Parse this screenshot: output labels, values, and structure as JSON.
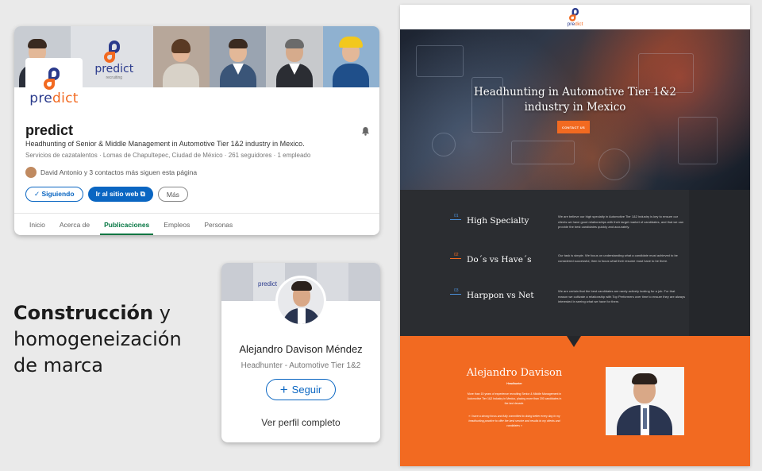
{
  "company_card": {
    "banner_logo_text": "predict",
    "banner_logo_subtext": "recruiting",
    "logo_text_prefix": "pre",
    "logo_text_suffix": "dict",
    "name": "predict",
    "tagline": "Headhunting of Senior & Middle Management in Automotive Tier 1&2 industry in Mexico.",
    "meta": "Servicios de cazatalentos · Lomas de Chapultepec, Ciudad de México · 261 seguidores · 1 empleado",
    "followers_text": "David Antonio y 3 contactos más siguen esta página",
    "actions": {
      "following": "✓ Siguiendo",
      "visit_site": "Ir al sitio web ⧉",
      "more": "Más"
    },
    "tabs": [
      "Inicio",
      "Acerca de",
      "Publicaciones",
      "Empleos",
      "Personas"
    ],
    "active_tab": "Publicaciones"
  },
  "headline": {
    "bold": "Construcción",
    "rest_1": " y",
    "line_2": "homogeneización",
    "line_3": "de marca"
  },
  "profile_card": {
    "banner_logo_text": "predict",
    "name": "Alejandro Davison Méndez",
    "role": "Headhunter - Automotive Tier 1&2",
    "follow_label": "Seguir",
    "follow_icon": "+",
    "view_profile": "Ver perfil completo"
  },
  "website": {
    "logo_text_prefix": "pre",
    "logo_text_suffix": "dict",
    "hero_title_1": "Headhunting in Automotive Tier 1&2",
    "hero_title_2": "industry in Mexico",
    "hero_button": "CONTACT US",
    "features": [
      {
        "num": "01",
        "title": "High Specialty",
        "text": "We are believe our high specialty in Automotive Tier 1&2 industry is key to ensure our clients we have good relationships with their target market of candidates, and that we can provide the best candidates quickly and accurately."
      },
      {
        "num": "02",
        "title": "Do´s vs Have´s",
        "text": "Our task is simple. We focus on understanding what a candidate must achieved to be considered successful, then to focus what their resume must have to be there."
      },
      {
        "num": "03",
        "title": "Harppon vs Net",
        "text": "We are certain that the best candidates are rarely actively looking for a job. For that reason we cultivate a relationship with Top Performers over time to ensure they are always interested in seeing what we have for them."
      }
    ],
    "about": {
      "name": "Alejandro Davison",
      "role": "Headhunter",
      "bio": "More than 15 years of experience recruiting Senior & Middle Management in Automotive Tier 1&2 industry in Mexico, placing more than 200 candidates in the last decade.",
      "quote": "« I have a strong focus and fully committed to doing better every day in my headhunting practice to offer the best service and results to my clients and candidates »"
    }
  },
  "colors": {
    "brand_orange": "#f26a21",
    "brand_navy": "#2a3a8c",
    "linkedin_blue": "#0a66c2",
    "linkedin_green": "#057642",
    "dark_section": "#25272b"
  }
}
